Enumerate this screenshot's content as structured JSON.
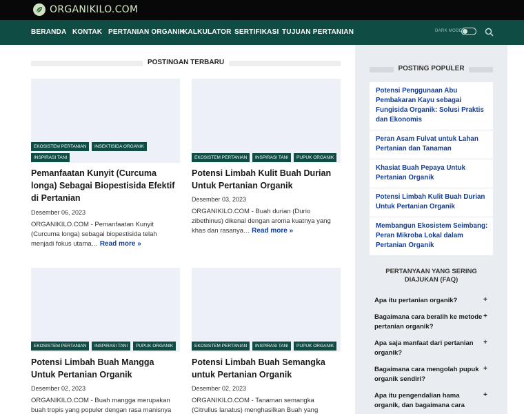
{
  "site": {
    "logo_text": "ORGANIKILO.COM"
  },
  "nav": {
    "items": [
      "BERANDA",
      "KONTAK",
      "PERTANIAN ORGANIK",
      "KALKULATOR",
      "SERTIFIKASI",
      "TUJUAN PERTANIAN"
    ],
    "dark_mode_label": "DARK MODE"
  },
  "main": {
    "heading": "POSTINGAN TERBARU",
    "read_more": "Read more »",
    "posts": [
      {
        "tags": [
          "EKOSISTEM PERTANIAN",
          "INSEKTISIDA ORGANIK",
          "INSPIRASI TANI"
        ],
        "title": "Pemanfaatan Kunyit (Curcuma longa) Sebagai Biopestisida Efektif di Pertanian",
        "date": "Desember 06, 2023",
        "excerpt": "ORGANIKILO.COM - Pemanfaatan Kunyit (Curcuma longa) sebagai biopestisida telah menjadi fokus utama…"
      },
      {
        "tags": [
          "EKOSISTEM PERTANIAN",
          "INSPIRASI TANI",
          "PUPUK ORGANIK"
        ],
        "title": "Potensi Limbah Kulit Buah Durian Untuk Pertanian Organik",
        "date": "Desember 03, 2023",
        "excerpt": "ORGANIKILO.COM - Buah durian (Durio zibethinus) dikenal dengan aroma kuatnya yang khas dan rasanya…"
      },
      {
        "tags": [
          "EKOSISTEM PERTANIAN",
          "INSPIRASI TANI",
          "PUPUK ORGANIK"
        ],
        "title": "Potensi Limbah Buah Mangga Untuk Pertanian Organik",
        "date": "Desember 02, 2023",
        "excerpt": "ORGANIKILO.COM - Buah mangga merupakan buah tropis yang populer dengan rasa manisnya"
      },
      {
        "tags": [
          "EKOSISTEM PERTANIAN",
          "INSPIRASI TANI",
          "PUPUK ORGANIK"
        ],
        "title": "Potensi Limbah Buah Semangka untuk Pertanian Organik",
        "date": "Desember 02, 2023",
        "excerpt": "ORGANIKILO.COM - Tanaman semangka (Citrullus lanatus) menghasilkan Buah yang"
      }
    ]
  },
  "sidebar": {
    "popular_heading": "POSTING POPULER",
    "popular": [
      "Potensi Penggunaan Abu Pembakaran Kayu sebagai Fungisida Organik: Solusi Praktis dan Ekonomis",
      "Peran Asam Fulvat untuk Lahan Pertanian dan Tanaman",
      "Khasiat Buah Pepaya Untuk Pertanian Organik",
      "Potensi Limbah Kulit Buah Durian Untuk Pertanian Organik",
      "Membangun Ekosistem Seimbang: Peran Mikroba Lokal dalam Pertanian Organik"
    ],
    "faq_heading": "PERTANYAAN YANG SERING DIAJUKAN (FAQ)",
    "faq_toggle": "+",
    "faq": [
      "Apa itu pertanian organik?",
      "Bagaimana cara beralih ke metode pertanian organik?",
      "Apa saja manfaat dari pertanian organik?",
      "Bagaimana cara mengolah pupuk organik sendiri?",
      "Apa itu pengendalian hama organik, dan bagaimana cara"
    ]
  },
  "colors": {
    "topbar": "#080808",
    "nav": "#0f4d44",
    "tag_bg": "#0f4d44",
    "link": "#0f3d99",
    "sidebar_bg": "#e9edf1",
    "thumb_placeholder": "#edf1f7"
  },
  "icons": {
    "logo": "leaf-logo-icon",
    "search": "search-icon",
    "faq_expand": "plus-icon"
  }
}
